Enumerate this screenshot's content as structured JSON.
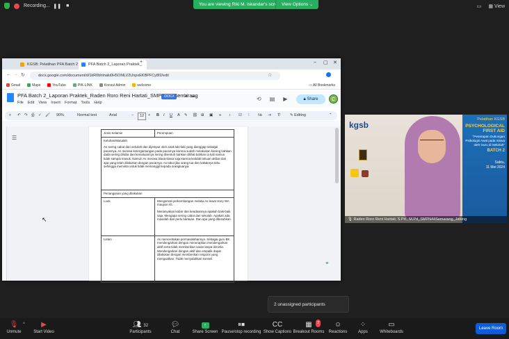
{
  "top": {
    "recording_label": "Recording...",
    "viewing_text": "You are viewing Riki M. Iskandar's screen",
    "view_options": "View Options",
    "view_label": "View"
  },
  "browser": {
    "tabs": [
      {
        "label": "KGSB: Pelatihan PFA Batch 2"
      },
      {
        "label": "PFA Batch 2_Laporan Praktek_"
      }
    ],
    "url": "docs.google.com/document/d/1kR0bhtnaki0H5OMLV2UnpxEKBPFCy8f2/edit",
    "bookmarks": [
      "Gmail",
      "Maps",
      "YouTube",
      "PIK-LINK",
      "Konsul Admin",
      "welcome"
    ],
    "all_bookmarks": "All Bookmarks"
  },
  "docs": {
    "title": "PFA Batch 2_Laporan Praktek_Raden Roro Reni Hartati_SMPN 44 Semarang",
    "badge": ".DOCX",
    "menu": [
      "File",
      "Edit",
      "View",
      "Insert",
      "Format",
      "Tools",
      "Help"
    ],
    "share_label": "Share",
    "avatar_letter": "C",
    "toolbar": {
      "zoom": "90%",
      "style": "Normal text",
      "font": "Arial",
      "size": "12",
      "mode": "Editing"
    },
    "table": {
      "jenis_kelamin_label": "Jenis Kelamin",
      "jenis_kelamin_value": "Perempuan",
      "keluhan_label": "Keluhan/Masalah",
      "keluhan_text": "As sering cabut dari sekolah dan dijemput oleh anak laki-laki yang dianggap sebagai pacarnya. As merasa ketergantungan pada pacarnya karena sudah melakukan kissing bahkan dada sering diraba dan kemaluannya sering disentuh bahkan dilihat bahkan ia kali namun tidak sampai masuk. Namun As merasa biasa-biasa saja karena ketidak tahuan akibat dari apa yang telah dilakukan dengan pacarnya. As takut jika orang tua dan kakaknya tahu sehingga meminta untuk tidak memanggil kepada orangtuanya.",
      "penanganan_label": "Penanganan yang dilakukan",
      "look_label": "Look",
      "look_text_1": "Mengamati perkembangan melalui As lewat story WA maupun IG.",
      "look_text_2": "Menanyakan kabar dan keadaannya apakah baik-baik saja. Mengapa sering cabut dari sekolah. Apakah ada masalah dan perlu bantuan. Dan apa yang dibutuhkan.",
      "listen_label": "Listen",
      "listen_text": "As menceritakan permasalahannya. Sebagai guru BK mendengarkan dengan menerapkan mendengarkan aktif serta tidak memberikan saran tanpa diminta. Mendengarkan dengan aktif dan empatik dapat dilakukan dengan memberikan respons yang menguatkan. Tidak menyalahkan konseli"
    }
  },
  "video": {
    "org": "kgsb",
    "program": "Pelatihan KGSB",
    "headline_1": "PSYCHOLOGICAL",
    "headline_2": "FIRST AID",
    "subtitle": "\"Penerapan Dukungan Psikologis Awal pada Siswa oleh Guru di Sekolah\"",
    "batch": "BATCH 2",
    "day": "Sabtu,",
    "date": "11 Mei 2024",
    "name_label": "Raden Roro Reni Hartati, S.Pd., M.Pd_SMPN44Semarang_Jateng"
  },
  "popup": {
    "text": "2 unassigned participants"
  },
  "bottom": {
    "items": [
      {
        "label": "Unmute",
        "icon": "mic-muted-icon"
      },
      {
        "label": "Start Video",
        "icon": "video-off-icon"
      },
      {
        "label": "Participants",
        "icon": "participants-icon",
        "count": "32"
      },
      {
        "label": "Chat",
        "icon": "chat-icon"
      },
      {
        "label": "Share Screen",
        "icon": "share-screen-icon"
      },
      {
        "label": "Pause/stop recording",
        "icon": "pause-stop-icon"
      },
      {
        "label": "Show Captions",
        "icon": "captions-icon"
      },
      {
        "label": "Breakout Rooms",
        "icon": "breakout-rooms-icon",
        "badge": "2"
      },
      {
        "label": "Reactions",
        "icon": "reactions-icon"
      },
      {
        "label": "Apps",
        "icon": "apps-icon"
      },
      {
        "label": "Whiteboards",
        "icon": "whiteboards-icon"
      }
    ],
    "leave_label": "Leave Room"
  },
  "colors": {
    "zoom_green": "#27ae60",
    "leave_blue": "#0e5cd7",
    "docs_blue": "#2684fc"
  }
}
